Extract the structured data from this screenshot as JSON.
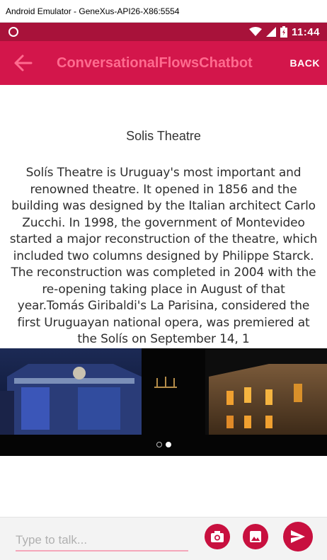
{
  "window": {
    "title": "Android Emulator - GeneXus-API26-X86:5554"
  },
  "status_bar": {
    "time": "11:44"
  },
  "app_bar": {
    "title": "ConversationalFlowsChatbot",
    "back_label": "BACK"
  },
  "card": {
    "title": "Solis Theatre",
    "body_lines": [
      "Solís Theatre is Uruguay's most important and",
      "renowned theatre. It opened in 1856 and the",
      "building was designed by the Italian architect Carlo",
      "Zucchi. In 1998, the government of Montevideo",
      "started a major reconstruction of the theatre, which",
      "included two columns designed by Philippe Starck.",
      "The reconstruction was completed in 2004 with the",
      "re-opening taking place in August of that",
      "year.Tomás Giribaldi's La Parisina, considered the",
      "first Uruguayan national opera, was premiered at",
      "the Solís on September 14, 1"
    ],
    "carousel": {
      "slide_count": 2,
      "active_index": 1
    }
  },
  "input": {
    "placeholder": "Type to talk...",
    "value": ""
  },
  "colors": {
    "status_bar": "#a8123a",
    "app_bar": "#d3164b",
    "title_text": "#ff6b8f",
    "accent": "#c8103f"
  },
  "icons": {
    "back": "arrow-left-icon",
    "camera": "camera-icon",
    "gallery": "image-icon",
    "send": "send-icon"
  }
}
